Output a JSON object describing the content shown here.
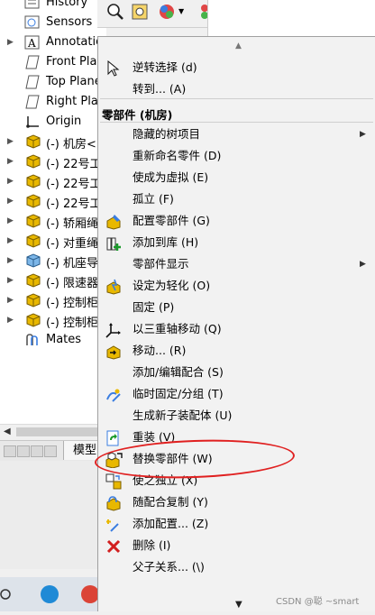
{
  "tree": {
    "items": [
      {
        "label": "History",
        "icon": "history-icon",
        "expandable": false
      },
      {
        "label": "Sensors",
        "icon": "sensors-icon",
        "expandable": false
      },
      {
        "label": "Annotatio",
        "icon": "annotations-icon",
        "expandable": true
      },
      {
        "label": "Front Plan",
        "icon": "plane-icon",
        "expandable": false
      },
      {
        "label": "Top Plane",
        "icon": "plane-icon",
        "expandable": false
      },
      {
        "label": "Right Plan",
        "icon": "plane-icon",
        "expandable": false
      },
      {
        "label": "Origin",
        "icon": "origin-icon",
        "expandable": false
      },
      {
        "label": "(-) 机房<1",
        "icon": "part-icon",
        "expandable": true
      },
      {
        "label": "(-) 22号工",
        "icon": "part-icon",
        "expandable": true
      },
      {
        "label": "(-) 22号工",
        "icon": "part-icon",
        "expandable": true
      },
      {
        "label": "(-) 22号工",
        "icon": "part-icon",
        "expandable": true
      },
      {
        "label": "(-) 轿厢绳",
        "icon": "part-icon",
        "expandable": true
      },
      {
        "label": "(-) 对重绳",
        "icon": "part-icon",
        "expandable": true
      },
      {
        "label": "(-) 机座导",
        "icon": "assembly-icon",
        "expandable": true
      },
      {
        "label": "(-) 限速器",
        "icon": "part-icon",
        "expandable": true
      },
      {
        "label": "(-) 控制柜",
        "icon": "part-icon",
        "expandable": true
      },
      {
        "label": "(-) 控制柜",
        "icon": "part-icon",
        "expandable": true
      },
      {
        "label": "Mates",
        "icon": "mates-icon",
        "expandable": false
      }
    ],
    "tab_label": "模型"
  },
  "menu": {
    "header": "零部件 (机房)",
    "items": [
      {
        "label": "逆转选择 (d)",
        "icon": "cursor-icon",
        "submenu": false
      },
      {
        "label": "转到... (A)",
        "icon": "",
        "submenu": false
      },
      {
        "label": "隐藏的树项目",
        "icon": "",
        "submenu": true
      },
      {
        "label": "重新命名零件 (D)",
        "icon": "",
        "submenu": false
      },
      {
        "label": "使成为虚拟 (E)",
        "icon": "",
        "submenu": false
      },
      {
        "label": "孤立 (F)",
        "icon": "",
        "submenu": false
      },
      {
        "label": "配置零部件 (G)",
        "icon": "configure-icon",
        "submenu": false
      },
      {
        "label": "添加到库 (H)",
        "icon": "add-library-icon",
        "submenu": false
      },
      {
        "label": "零部件显示",
        "icon": "",
        "submenu": true
      },
      {
        "label": "设定为轻化 (O)",
        "icon": "lightweight-icon",
        "submenu": false
      },
      {
        "label": "固定 (P)",
        "icon": "",
        "submenu": false
      },
      {
        "label": "以三重轴移动 (Q)",
        "icon": "triad-icon",
        "submenu": false
      },
      {
        "label": "移动... (R)",
        "icon": "move-icon",
        "submenu": false
      },
      {
        "label": "添加/编辑配合 (S)",
        "icon": "",
        "submenu": false
      },
      {
        "label": "临时固定/分组 (T)",
        "icon": "temp-fix-icon",
        "submenu": false
      },
      {
        "label": "生成新子装配体 (U)",
        "icon": "",
        "submenu": false
      },
      {
        "label": "重装 (V)",
        "icon": "reload-icon",
        "submenu": false
      },
      {
        "label": "替换零部件 (W)",
        "icon": "replace-icon",
        "submenu": false
      },
      {
        "label": "使之独立 (X)",
        "icon": "independent-icon",
        "submenu": false
      },
      {
        "label": "随配合复制 (Y)",
        "icon": "copy-mates-icon",
        "submenu": false
      },
      {
        "label": "添加配置... (Z)",
        "icon": "add-config-icon",
        "submenu": false
      },
      {
        "label": "删除 (I)",
        "icon": "delete-icon",
        "submenu": false
      },
      {
        "label": "父子关系... (\\)",
        "icon": "",
        "submenu": false
      }
    ]
  },
  "watermark": "CSDN @聪   ~smart",
  "colors": {
    "annotation_circle": "#e02020",
    "delete_icon": "#d21f1f",
    "part_icon": "#e8b800"
  }
}
